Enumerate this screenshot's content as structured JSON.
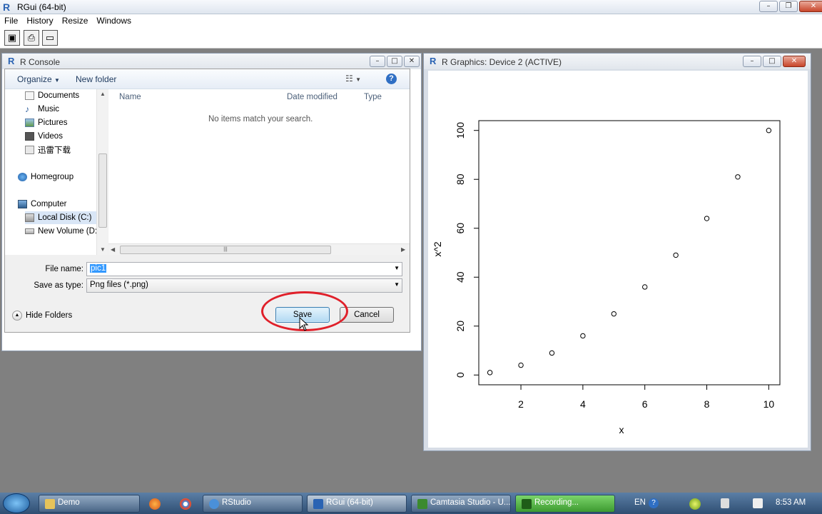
{
  "rgui": {
    "title": "RGui (64-bit)",
    "menu": [
      "File",
      "History",
      "Resize",
      "Windows"
    ]
  },
  "console": {
    "title": "R Console"
  },
  "dialog": {
    "organize_label": "Organize",
    "new_folder_label": "New folder",
    "nav_items": [
      {
        "label": "Documents",
        "icon": "documents-icon"
      },
      {
        "label": "Music",
        "icon": "music-icon"
      },
      {
        "label": "Pictures",
        "icon": "pictures-icon"
      },
      {
        "label": "Videos",
        "icon": "videos-icon"
      },
      {
        "label": "迅雷下载",
        "icon": "folder-icon"
      },
      {
        "label": "Homegroup",
        "icon": "homegroup-icon"
      },
      {
        "label": "Computer",
        "icon": "computer-icon"
      },
      {
        "label": "Local Disk (C:)",
        "icon": "disk-icon"
      },
      {
        "label": "New Volume (D:)",
        "icon": "disk-icon"
      }
    ],
    "columns": [
      "Name",
      "Date modified",
      "Type"
    ],
    "empty_message": "No items match your search.",
    "file_name_label": "File name:",
    "file_name_value": "pic1",
    "save_as_type_label": "Save as type:",
    "save_as_type_value": "Png files (*.png)",
    "hide_folders_label": "Hide Folders",
    "save_label": "Save",
    "cancel_label": "Cancel",
    "highlight_color": "#e0202a"
  },
  "graphics": {
    "title": "R Graphics: Device 2 (ACTIVE)"
  },
  "chart_data": {
    "type": "scatter",
    "x": [
      1,
      2,
      3,
      4,
      5,
      6,
      7,
      8,
      9,
      10
    ],
    "y": [
      1,
      4,
      9,
      16,
      25,
      36,
      49,
      64,
      81,
      100
    ],
    "xlabel": "x",
    "ylabel": "x^2",
    "xlim": [
      1,
      10
    ],
    "ylim": [
      0,
      100
    ],
    "xticks": [
      2,
      4,
      6,
      8,
      10
    ],
    "yticks": [
      0,
      20,
      40,
      60,
      80,
      100
    ],
    "marker": "open-circle",
    "grid": false
  },
  "taskbar": {
    "items": [
      {
        "label": "Demo",
        "icon": "folder-icon"
      },
      {
        "label": "RStudio",
        "icon": "rstudio-icon"
      },
      {
        "label": "RGui (64-bit)",
        "icon": "r-icon"
      },
      {
        "label": "Camtasia Studio - U...",
        "icon": "camtasia-icon"
      },
      {
        "label": "Recording...",
        "icon": "camtasia-icon"
      }
    ],
    "language": "EN",
    "clock": "8:53 AM"
  }
}
